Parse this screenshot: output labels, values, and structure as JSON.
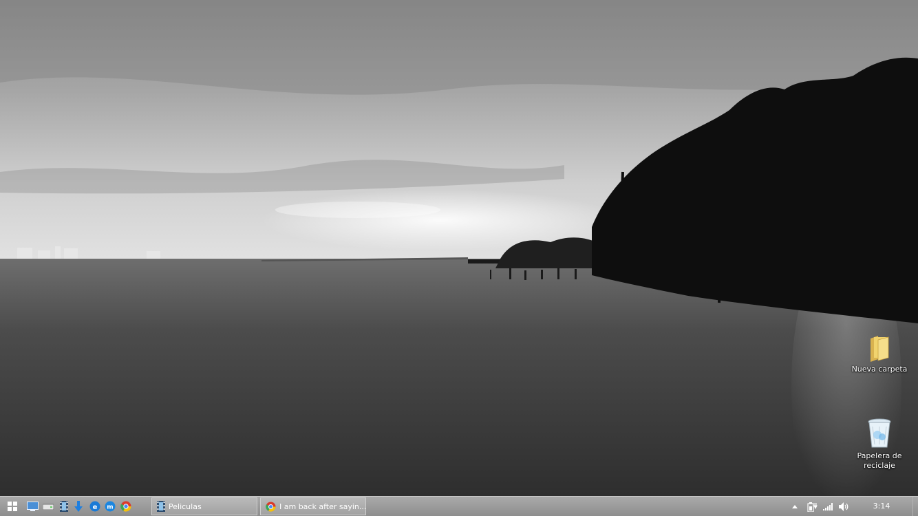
{
  "desktop": {
    "icons": [
      {
        "label": "Nueva carpeta",
        "icon": "folder-icon"
      },
      {
        "label": "Papelera de\nreciclaje",
        "icon": "recycle-bin-icon"
      }
    ]
  },
  "taskbar": {
    "quick_launch": [
      "start-icon",
      "desktop-icon",
      "drive-icon",
      "film-icon",
      "download-icon",
      "ie-icon",
      "messenger-icon",
      "chrome-icon"
    ],
    "tasks": [
      {
        "label": "Peliculas",
        "icon": "film-icon"
      },
      {
        "label": "I am back after sayin...",
        "icon": "chrome-icon"
      }
    ],
    "tray": [
      "show-hidden-icons-arrow",
      "power-icon",
      "network-signal-icon",
      "volume-icon"
    ],
    "clock": "3:14"
  },
  "colors": {
    "taskbar": "#9b9b9b",
    "task_button": "#adadad",
    "folder": "#f1d36e",
    "recycle_bin": "#9fd0f2"
  }
}
